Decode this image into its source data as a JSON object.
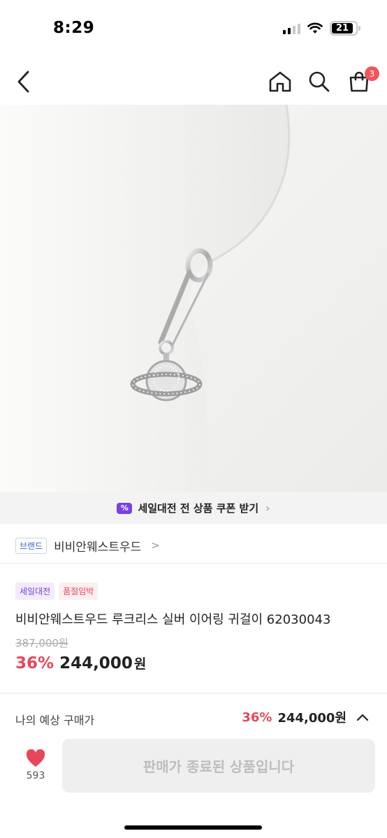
{
  "status_bar": {
    "time": "8:29",
    "battery": "21",
    "icons": [
      "cellular-signal-icon",
      "wifi-icon",
      "battery-icon"
    ]
  },
  "header": {
    "icons": [
      "back-arrow-icon",
      "home-icon",
      "search-icon",
      "shopping-bag-icon"
    ],
    "cart_count": "3"
  },
  "coupon_banner": {
    "icon": "coupon-percent-icon",
    "icon_text": "%",
    "text": "세일대전 전 상품 쿠폰 받기"
  },
  "brand": {
    "tag": "브랜드",
    "name": "비비안웨스트우드",
    "chevron": ">"
  },
  "product": {
    "badges": [
      "세일대전",
      "품절임박"
    ],
    "title": "비비안웨스트우드 루크리스 실버 이어링 귀걸이 62030043",
    "original_price": "387,000원",
    "discount": "36%",
    "sale_price": "244,000",
    "currency": "원"
  },
  "purchase_panel": {
    "expected_label": "나의 예상 구매가",
    "expected_discount": "36%",
    "expected_price": "244,000원",
    "like_count": "593",
    "cta_label": "판매가 종료된 상품입니다"
  },
  "colors": {
    "accent_red": "#e6475a",
    "badge_red": "#f0565d",
    "accent_purple": "#7b3fe4",
    "brand_blue": "#3c64c8"
  }
}
